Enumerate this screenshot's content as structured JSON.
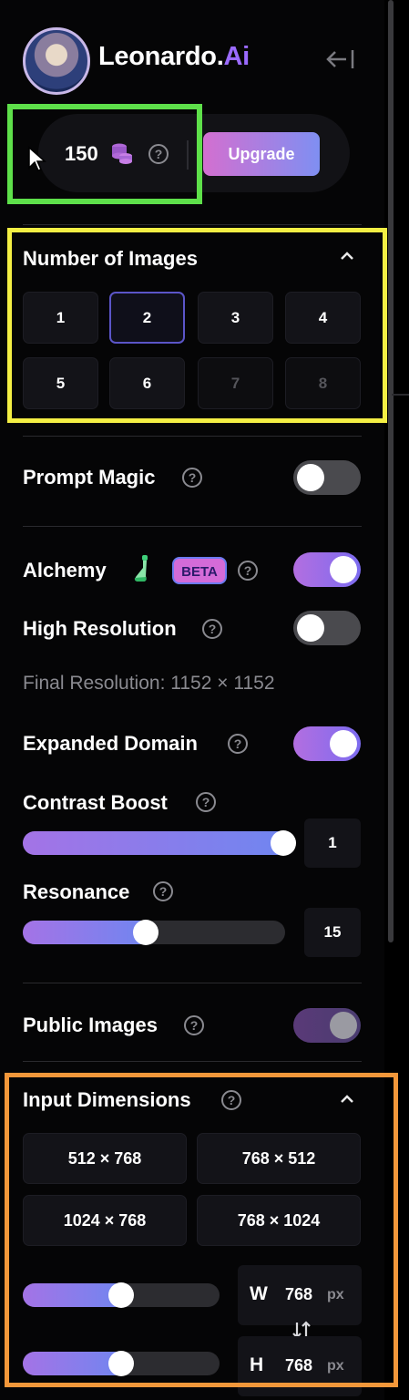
{
  "brand": {
    "name": "Leonardo.",
    "suffix": "Ai"
  },
  "credits": {
    "amount": "150",
    "upgrade_label": "Upgrade"
  },
  "number_of_images": {
    "title": "Number of Images",
    "options": [
      "1",
      "2",
      "3",
      "4",
      "5",
      "6",
      "7",
      "8"
    ],
    "selected": "2",
    "disabled": [
      "7",
      "8"
    ]
  },
  "prompt_magic": {
    "label": "Prompt Magic",
    "enabled": false
  },
  "alchemy": {
    "label": "Alchemy",
    "badge": "BETA",
    "enabled": true
  },
  "high_resolution": {
    "label": "High Resolution",
    "enabled": false
  },
  "final_resolution": "Final Resolution: 1152 × 1152",
  "expanded_domain": {
    "label": "Expanded Domain",
    "enabled": true
  },
  "contrast_boost": {
    "label": "Contrast Boost",
    "value": "1",
    "fill_fraction": 0.98
  },
  "resonance": {
    "label": "Resonance",
    "value": "15",
    "fill_fraction": 0.47
  },
  "public_images": {
    "label": "Public Images",
    "enabled": true
  },
  "input_dimensions": {
    "title": "Input Dimensions",
    "presets": [
      "512 × 768",
      "768 × 512",
      "1024 × 768",
      "768 × 1024"
    ],
    "width": {
      "label": "W",
      "value": "768",
      "unit": "px",
      "fill_fraction": 0.5
    },
    "height": {
      "label": "H",
      "value": "768",
      "unit": "px",
      "fill_fraction": 0.5
    }
  },
  "icons": {
    "collapse": "collapse-sidebar-icon",
    "coin": "coin-stack-icon",
    "help": "question-circle-icon",
    "chevron": "chevron-up-icon",
    "flask": "flask-icon",
    "swap": "swap-arrows-icon"
  },
  "colors": {
    "accent_gradient_start": "#b36ee0",
    "accent_gradient_end": "#7c6cf0",
    "brand_ai": "#9b6bff",
    "highlight_green": "#5ee04a",
    "highlight_yellow": "#f4ef44",
    "highlight_orange": "#f2973a"
  }
}
